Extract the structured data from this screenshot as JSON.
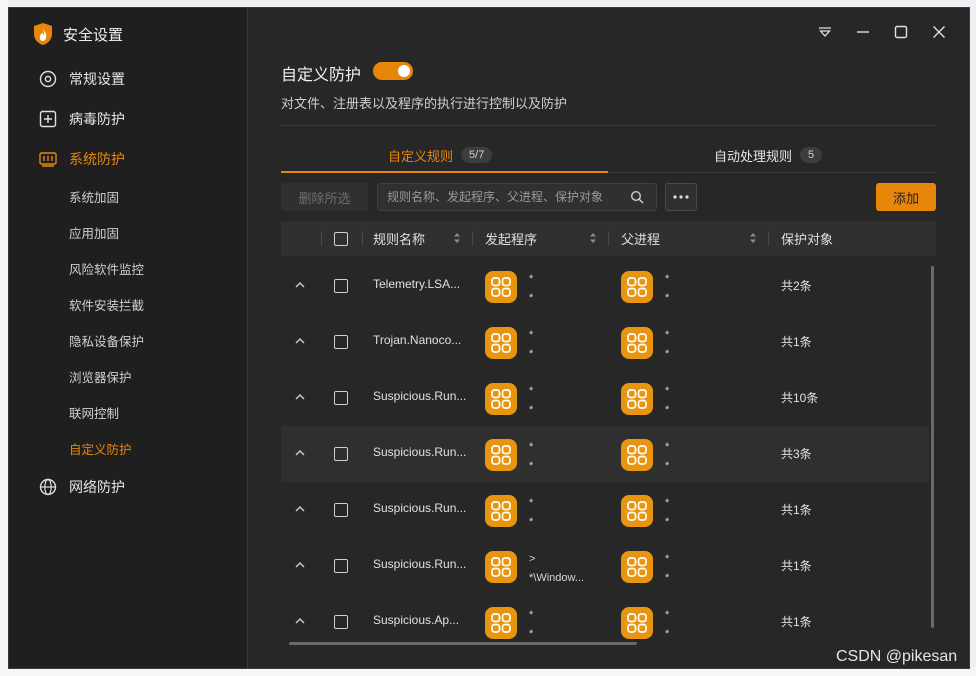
{
  "app": {
    "title": "安全设置"
  },
  "sidebar": {
    "groups": [
      {
        "label": "常规设置",
        "icon": "gear-icon"
      },
      {
        "label": "病毒防护",
        "icon": "plus-square-icon"
      },
      {
        "label": "系统防护",
        "icon": "system-icon",
        "active": true
      },
      {
        "label": "网络防护",
        "icon": "globe-icon"
      }
    ],
    "sub_items": [
      {
        "label": "系统加固"
      },
      {
        "label": "应用加固"
      },
      {
        "label": "风险软件监控"
      },
      {
        "label": "软件安装拦截"
      },
      {
        "label": "隐私设备保护"
      },
      {
        "label": "浏览器保护"
      },
      {
        "label": "联网控制"
      },
      {
        "label": "自定义防护",
        "active": true
      }
    ]
  },
  "window_controls": [
    "menu-icon",
    "minimize-icon",
    "maximize-icon",
    "close-icon"
  ],
  "main": {
    "section_title": "自定义防护",
    "toggle_on": true,
    "description": "对文件、注册表以及程序的执行进行控制以及防护",
    "tabs": [
      {
        "label": "自定义规则",
        "badge": "5/7",
        "active": true
      },
      {
        "label": "自动处理规则",
        "badge": "5"
      }
    ],
    "toolbar": {
      "delete_label": "删除所选",
      "search_placeholder": "规则名称、发起程序、父进程、保护对象",
      "add_label": "添加"
    },
    "table": {
      "columns": [
        "规则名称",
        "发起程序",
        "父进程",
        "保护对象"
      ],
      "rows": [
        {
          "name": "Telemetry.LSA...",
          "initiator": [
            "*",
            "*"
          ],
          "parent": [
            "*",
            "*"
          ],
          "protect": "共2条"
        },
        {
          "name": "Trojan.Nanoco...",
          "initiator": [
            "*",
            "*"
          ],
          "parent": [
            "*",
            "*"
          ],
          "protect": "共1条"
        },
        {
          "name": "Suspicious.Run...",
          "initiator": [
            "*",
            "*"
          ],
          "parent": [
            "*",
            "*"
          ],
          "protect": "共10条"
        },
        {
          "name": "Suspicious.Run...",
          "initiator": [
            "*",
            "*"
          ],
          "parent": [
            "*",
            "*"
          ],
          "protect": "共3条",
          "highlighted": true
        },
        {
          "name": "Suspicious.Run...",
          "initiator": [
            "*",
            "*"
          ],
          "parent": [
            "*",
            "*"
          ],
          "protect": "共1条"
        },
        {
          "name": "Suspicious.Run...",
          "initiator": [
            ">",
            "*\\Window..."
          ],
          "parent": [
            "*",
            "*"
          ],
          "protect": "共1条"
        },
        {
          "name": "Suspicious.Ap...",
          "initiator": [
            "*",
            "*"
          ],
          "parent": [
            "*",
            "*"
          ],
          "protect": "共1条"
        }
      ]
    }
  },
  "watermark": "CSDN @pikesan",
  "colors": {
    "accent": "#e8860c",
    "background": "#272727",
    "sidebar": "#1f1f1f"
  }
}
